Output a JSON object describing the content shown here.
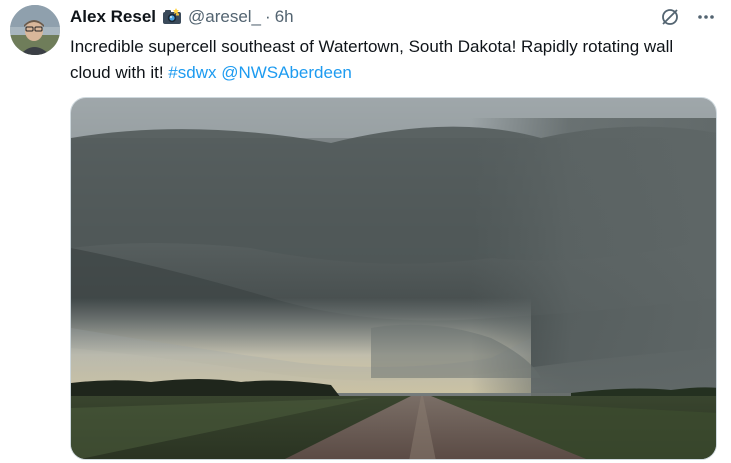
{
  "tweet": {
    "author": {
      "name": "Alex Resel",
      "handle": "@aresel_",
      "badge_icon": "camera-emoji-icon"
    },
    "separator": "·",
    "time": "6h",
    "text_plain": "Incredible supercell southeast of Watertown, South Dakota! Rapidly rotating wall cloud with it!",
    "hashtag": "#sdwx",
    "mention": "@NWSAberdeen",
    "actions": {
      "grok_icon": "grok-icon",
      "more_icon": "more-horizontal-icon"
    },
    "media": {
      "description_icon": "photo"
    },
    "colors": {
      "link": "#1d9bf0",
      "secondary_text": "#536471",
      "primary_text": "#0f1419"
    }
  }
}
